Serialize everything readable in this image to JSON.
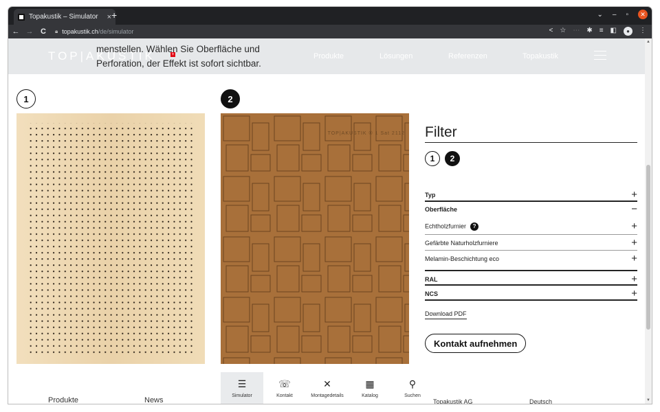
{
  "browser": {
    "tab_title": "Topakustik – Simulator",
    "tab_close": "×",
    "new_tab": "+",
    "url_domain": "topakustik.ch",
    "url_path": "/de/simulator",
    "back": "←",
    "forward": "→",
    "reload": "C"
  },
  "header": {
    "logo": "TOP|AKUSTIK",
    "intro": "menstellen. Wählen Sie Oberfläche und Perforation, der Effekt ist sofort sichtbar.",
    "nav": [
      "Produkte",
      "Lösungen",
      "Referenzen",
      "Topakustik"
    ]
  },
  "panels": {
    "one_label": "1",
    "two_label": "2",
    "brand_mark": "TOP|AKUSTIK ® 1 Sat 2112"
  },
  "filter": {
    "title": "Filter",
    "step1": "1",
    "step2": "2",
    "rows": {
      "typ": "Typ",
      "oberflaeche": "Oberfläche",
      "echtholz": "Echtholzfurnier",
      "gefaerbte": "Gefärbte Naturholzfurniere",
      "melamin": "Melamin-Beschichtung eco",
      "ral": "RAL",
      "ncs": "NCS"
    },
    "plus": "+",
    "minus": "−",
    "help": "?",
    "download": "Download PDF",
    "contact": "Kontakt aufnehmen"
  },
  "dock": [
    {
      "label": "Simulator",
      "icon": "☰"
    },
    {
      "label": "Kontakt",
      "icon": "☏"
    },
    {
      "label": "Montagedetails",
      "icon": "✕"
    },
    {
      "label": "Katalog",
      "icon": "▦"
    },
    {
      "label": "Suchen",
      "icon": "⚲"
    }
  ],
  "footer": {
    "produkte": "Produkte",
    "news": "News",
    "company": "Topakustik AG",
    "language": "Deutsch"
  },
  "colors": {
    "panel1_wood": "#efd9b4",
    "panel2_wood": "#a8703a"
  }
}
